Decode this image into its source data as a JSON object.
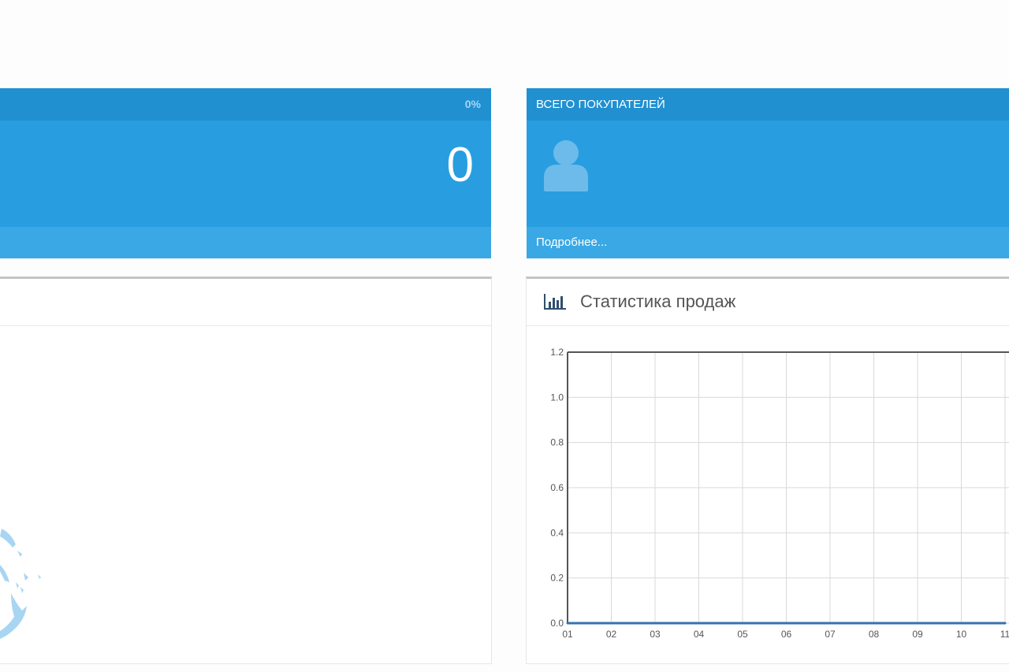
{
  "tile_left": {
    "percent": "0%",
    "value": "0"
  },
  "tile_right": {
    "title": "ВСЕГО ПОКУПАТЕЛЕЙ",
    "more_link": "Подробнее..."
  },
  "sales_panel": {
    "title": "Статистика продаж"
  },
  "colors": {
    "tile": "#289ee1",
    "tile_header": "#2090d1",
    "tile_footer": "#3aa8e4",
    "series": "#3572b0"
  },
  "chart_data": {
    "type": "line",
    "title": "",
    "xlabel": "",
    "ylabel": "",
    "x": [
      "01",
      "02",
      "03",
      "04",
      "05",
      "06",
      "07",
      "08",
      "09",
      "10",
      "11"
    ],
    "y_ticks": [
      "0.0",
      "0.2",
      "0.4",
      "0.6",
      "0.8",
      "1.0",
      "1.2"
    ],
    "ylim": [
      0,
      1.2
    ],
    "grid": true,
    "series": [
      {
        "values": [
          0,
          0,
          0,
          0,
          0,
          0,
          0,
          0,
          0,
          0,
          0
        ]
      }
    ]
  }
}
